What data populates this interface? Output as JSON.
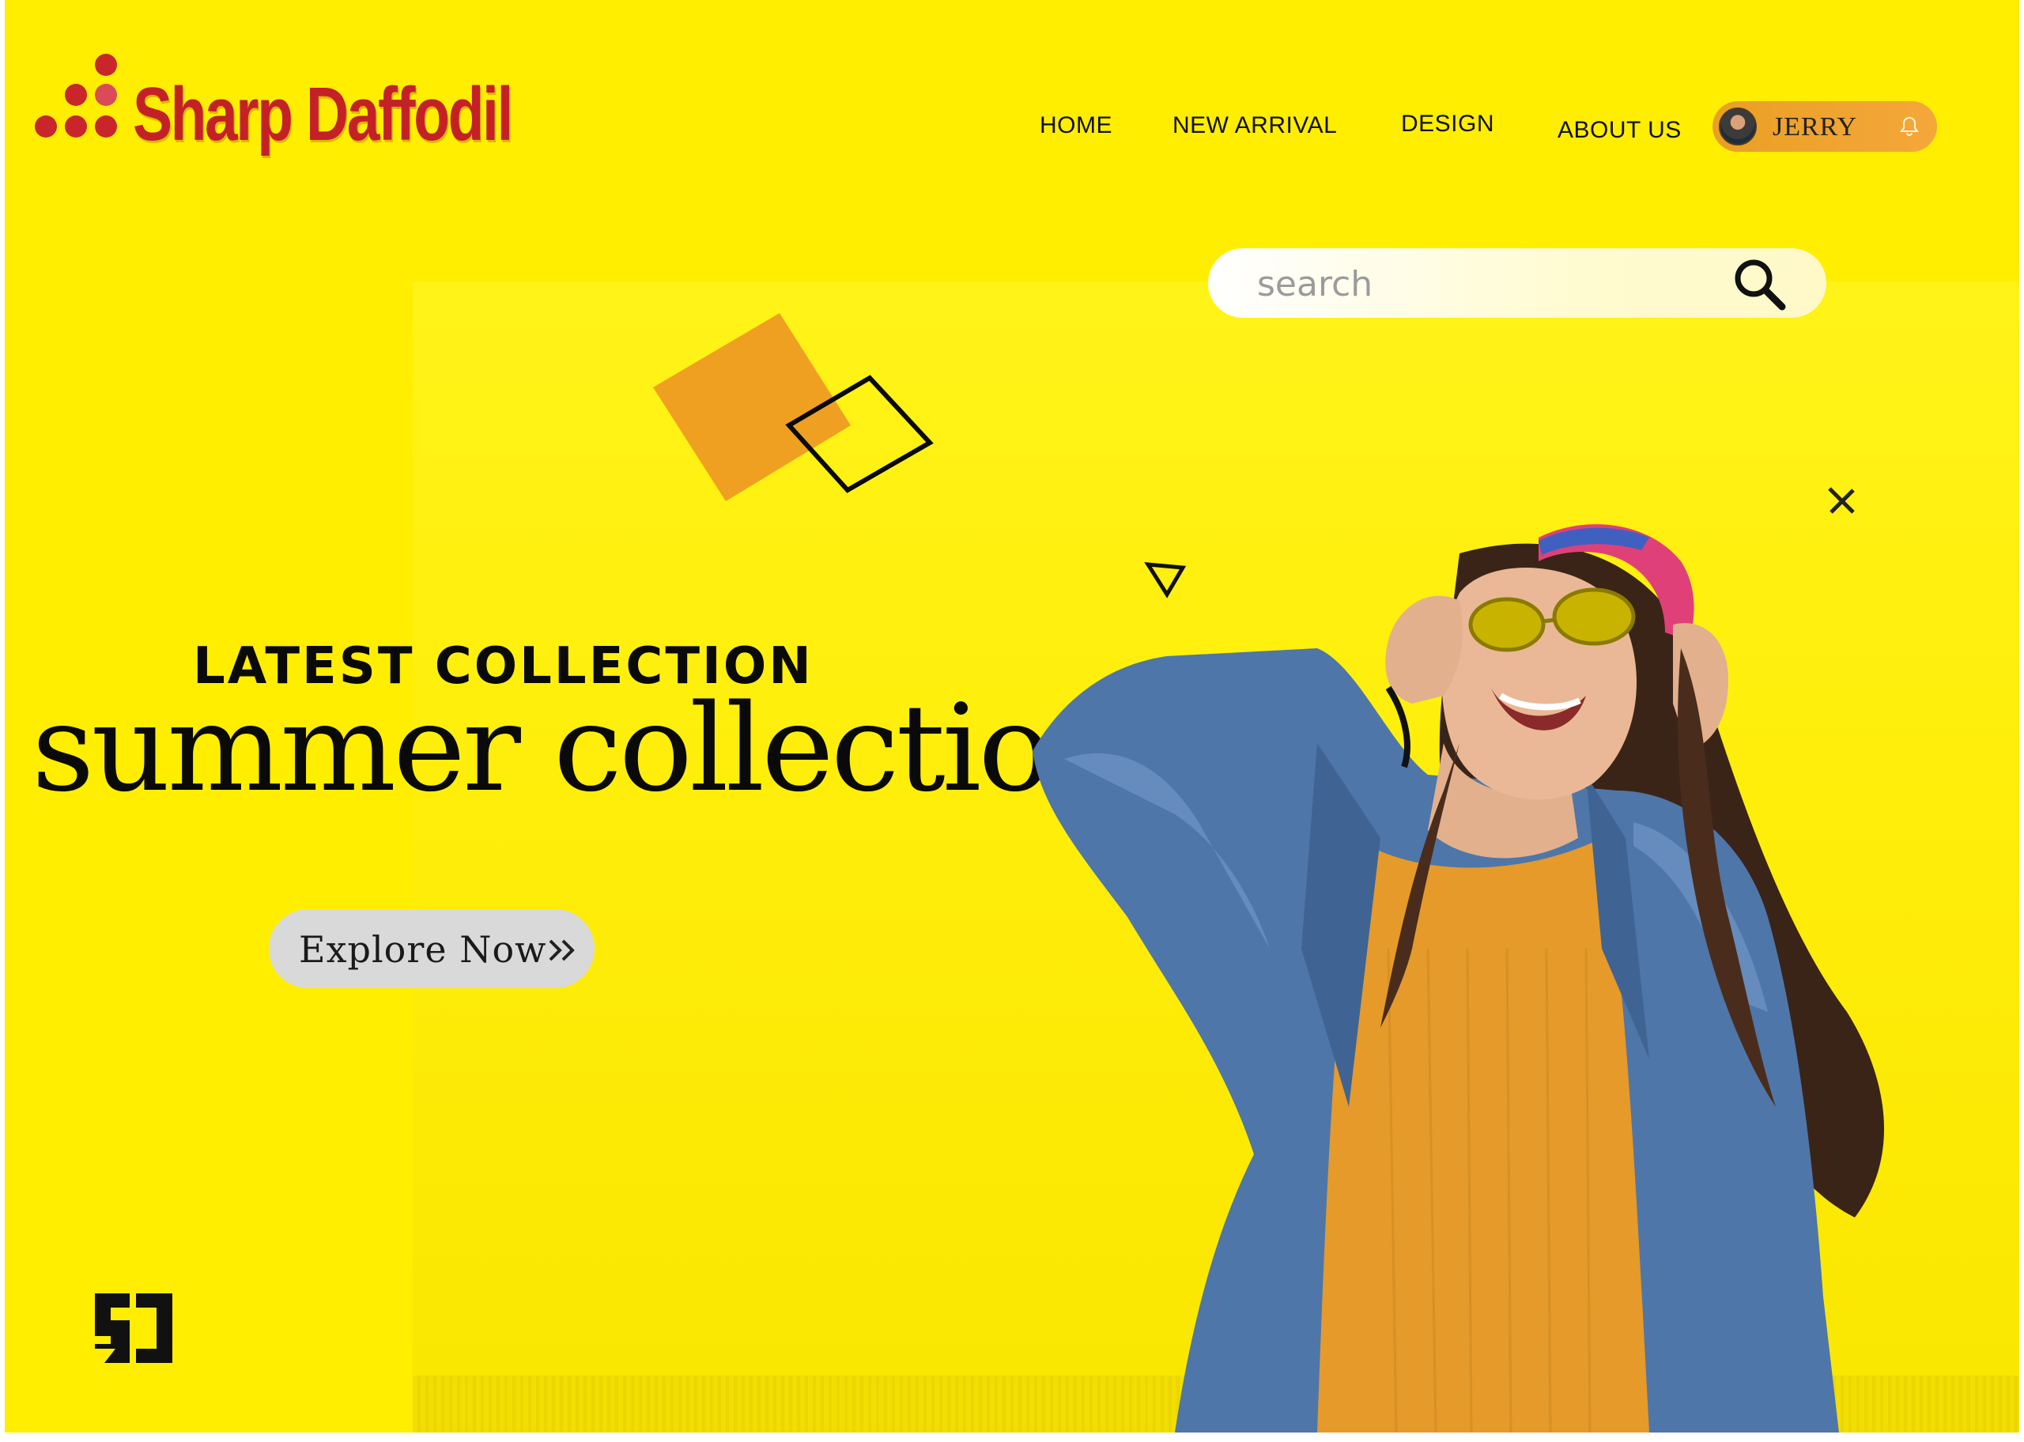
{
  "brand": {
    "name": "Sharp Daffodil",
    "color": "#c42127"
  },
  "nav": {
    "items": [
      {
        "label": "HOME"
      },
      {
        "label": "NEW  ARRIVAL"
      },
      {
        "label": "DESIGN"
      },
      {
        "label": "ABOUT US"
      }
    ]
  },
  "user": {
    "name": "JERRY",
    "avatar_icon": "avatar",
    "notification_icon": "bell-icon"
  },
  "search": {
    "placeholder": "search",
    "icon": "search-icon"
  },
  "hero": {
    "kicker": "LATEST COLLECTION",
    "headline": "summer collection",
    "cta_label": "Explore Now",
    "cta_icon": "double-chevron-right-icon"
  },
  "colors": {
    "background": "#ffee00",
    "accent_orange": "#f0a030",
    "text": "#0a0a0a",
    "cta_background": "#d9d9d9"
  }
}
